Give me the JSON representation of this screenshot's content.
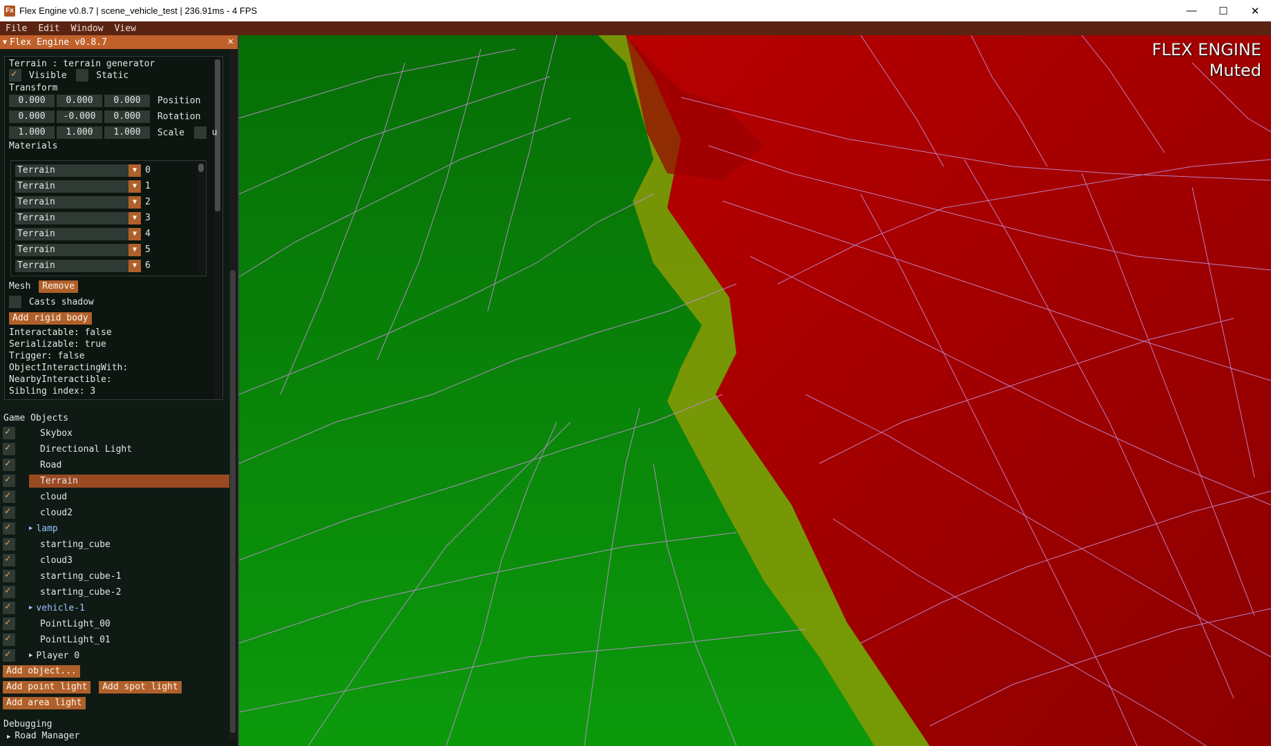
{
  "window": {
    "title": "Flex Engine v0.8.7 | scene_vehicle_test | 236.91ms - 4 FPS",
    "app_icon": "Fx",
    "minimize": "—",
    "maximize": "☐",
    "close": "✕"
  },
  "menu": [
    "File",
    "Edit",
    "Window",
    "View"
  ],
  "viewport": {
    "overlay_line1": "FLEX ENGINE",
    "overlay_line2": "Muted"
  },
  "panel": {
    "title": "Flex Engine v0.8.7",
    "close": "✕",
    "inspector": {
      "object_title": "Terrain : terrain generator",
      "visible_label": "Visible",
      "visible": true,
      "static_label": "Static",
      "static": false,
      "transform_label": "Transform",
      "position": [
        "0.000",
        "0.000",
        "0.000"
      ],
      "position_label": "Position",
      "rotation": [
        "0.000",
        "-0.000",
        "0.000"
      ],
      "rotation_label": "Rotation",
      "scale": [
        "1.000",
        "1.000",
        "1.000"
      ],
      "scale_label": "Scale",
      "uniform_label": "u",
      "materials_label": "Materials",
      "materials": [
        {
          "name": "Terrain",
          "index": "0"
        },
        {
          "name": "Terrain",
          "index": "1"
        },
        {
          "name": "Terrain",
          "index": "2"
        },
        {
          "name": "Terrain",
          "index": "3"
        },
        {
          "name": "Terrain",
          "index": "4"
        },
        {
          "name": "Terrain",
          "index": "5"
        },
        {
          "name": "Terrain",
          "index": "6"
        }
      ],
      "mesh_label": "Mesh",
      "remove_label": "Remove",
      "casts_shadow_label": "Casts shadow",
      "add_rigid_body_label": "Add rigid body",
      "info_lines": [
        "Interactable: false",
        "Serializable: true",
        "Trigger: false",
        "ObjectInteractingWith:",
        "NearbyInteractible:",
        "Sibling index: 3"
      ]
    },
    "game_objects_label": "Game Objects",
    "game_objects": [
      {
        "name": "Skybox",
        "expandable": false,
        "selected": false
      },
      {
        "name": "Directional Light",
        "expandable": false,
        "selected": false
      },
      {
        "name": "Road",
        "expandable": false,
        "selected": false
      },
      {
        "name": "Terrain",
        "expandable": false,
        "selected": true
      },
      {
        "name": "cloud",
        "expandable": false,
        "selected": false
      },
      {
        "name": "cloud2",
        "expandable": false,
        "selected": false
      },
      {
        "name": "lamp",
        "expandable": true,
        "selected": false
      },
      {
        "name": "starting_cube",
        "expandable": false,
        "selected": false
      },
      {
        "name": "cloud3",
        "expandable": false,
        "selected": false
      },
      {
        "name": "starting_cube-1",
        "expandable": false,
        "selected": false
      },
      {
        "name": "starting_cube-2",
        "expandable": false,
        "selected": false
      },
      {
        "name": "vehicle-1",
        "expandable": true,
        "selected": false
      },
      {
        "name": "PointLight_00",
        "expandable": false,
        "selected": false
      },
      {
        "name": "PointLight_01",
        "expandable": false,
        "selected": false
      },
      {
        "name": "Player 0",
        "expandable": true,
        "selected": false
      }
    ],
    "add_object_label": "Add object...",
    "add_point_light_label": "Add point light",
    "add_spot_light_label": "Add spot light",
    "add_area_light_label": "Add area light",
    "debugging_label": "Debugging",
    "road_manager_label": "Road Manager"
  },
  "colors": {
    "accent": "#c0602a",
    "panel_bg": "#0f1a14",
    "terrain_green": "#0a8a0a",
    "terrain_yellow": "#8a9a06",
    "terrain_red": "#a00000",
    "wireframe": "#c48cd6"
  }
}
